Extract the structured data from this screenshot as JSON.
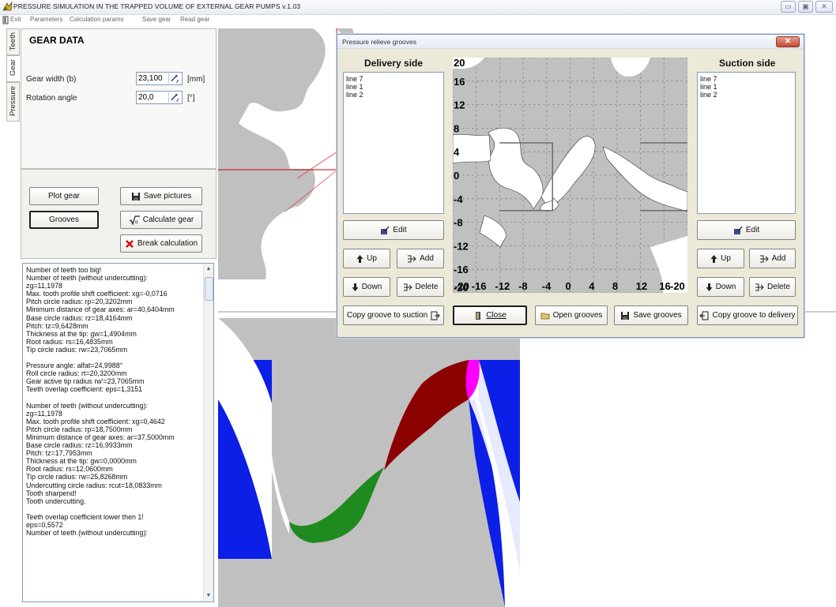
{
  "window": {
    "title": "PRESSURE SIMULATION IN THE TRAPPED VOLUME OF EXTERNAL GEAR PUMPS v.1.03"
  },
  "menu": {
    "items": [
      "Exit",
      "Parameters",
      "Calculation params",
      "Save gear",
      "Read gear"
    ]
  },
  "side_tabs": [
    "Teeth",
    "Gear",
    "Pressure"
  ],
  "gear_panel": {
    "title": "GEAR DATA",
    "gear_width_label": "Gear width (b)",
    "gear_width_value": "23,100",
    "gear_width_unit": "[mm]",
    "rotation_angle_label": "Rotation angle",
    "rotation_angle_value": "20,0",
    "rotation_angle_unit": "[°]"
  },
  "buttons": {
    "plot_gear": "Plot gear",
    "save_pictures": "Save pictures",
    "grooves": "Grooves",
    "calculate_gear": "Calculate gear",
    "break_calculation": "Break calculation"
  },
  "log_lines": [
    "Number of teeth too big!",
    "Number of teeth (without undercutting):",
    "zg=11,1978",
    "Max. tooth profile shift coefficient: xg=-0,0716",
    "Pitch circle radius: rp=20,3202mm",
    "Minimum distance of gear axes: ar=40,6404mm",
    "Base circle radius: rz=18,4164mm",
    "Pitch: tz=9,6428mm",
    "Thickness at the tip: gw=1,4904mm",
    "Root radius: rs=16,4835mm",
    "Tip circle radius: rw=23,7065mm",
    "",
    "Pressure angle: alfat=24,9988°",
    "Roll circle radius: rt=20,3200mm",
    "Gear active tip radius rw'=23,7065mm",
    "Teeth overlap coefficient: eps=1,3151",
    "",
    "Number of teeth (without undercutting):",
    "zg=11,1978",
    "Max. tooth profile shift coefficient: xg=0,4642",
    "Pitch circle radius: rp=18,7500mm",
    "Minimum distance of gear axes: ar=37,5000mm",
    "Base circle radius: rz=16,9933mm",
    "Pitch: tz=17,7953mm",
    "Thickness at the tip: gw=0,0000mm",
    "Root radius: rs=12,0600mm",
    "Tip circle radius: rw=25,8268mm",
    "Undercutting circle radius: rcut=18,0833mm",
    "Tooth sharpend!",
    "Tooth undercutting.",
    "",
    "Teeth overlap coefficient lower then 1!",
    "eps=0,5572",
    "Number of teeth (without undercutting):"
  ],
  "dialog": {
    "title": "Pressure relieve grooves",
    "delivery_title": "Delivery side",
    "suction_title": "Suction side",
    "delivery_items": [
      "line 7",
      "line 1",
      "line 2"
    ],
    "suction_items": [
      "line 7",
      "line 1",
      "line 2"
    ],
    "edit": "Edit",
    "up": "Up",
    "add": "Add",
    "down": "Down",
    "delete": "Delete",
    "copy_to_suction": "Copy groove to suction",
    "close": "Close",
    "open_grooves": "Open grooves",
    "save_grooves": "Save grooves",
    "copy_to_delivery": "Copy groove to delivery"
  },
  "chart_data": {
    "type": "line",
    "title": "",
    "xlabel": "",
    "ylabel": "",
    "xlim": [
      -20,
      20
    ],
    "ylim": [
      -20,
      20
    ],
    "x_ticks": [
      "-20",
      "-16",
      "-12",
      "-8",
      "-4",
      "0",
      "4",
      "8",
      "12",
      "16",
      "-20"
    ],
    "y_ticks": [
      "20",
      "16",
      "12",
      "8",
      "4",
      "0",
      "-4",
      "-8",
      "-12",
      "-16",
      "-20"
    ],
    "grid": true,
    "series": [
      {
        "values": [
          [
            -12,
            5.5
          ],
          [
            -3,
            5.5
          ],
          [
            -3,
            -6
          ],
          [
            -12,
            -6
          ]
        ]
      },
      {
        "values": [
          [
            12,
            5.5
          ],
          [
            21,
            5.5
          ],
          [
            21,
            -6
          ],
          [
            12,
            -6
          ]
        ]
      }
    ],
    "colors": {
      "background": "#c0c0c0",
      "grid": "#8a8a8a",
      "groove": "#6c6c6c"
    }
  },
  "colors": {
    "blue": "#0b1fe6",
    "dark_red": "#8b0000",
    "green": "#1f8a1f",
    "magenta": "#ff00ff",
    "gray": "#c0c0c0"
  }
}
